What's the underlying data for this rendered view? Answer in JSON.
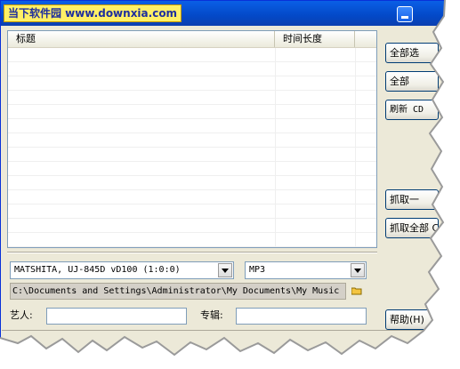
{
  "window": {
    "watermark": "当下软件园 www.downxia.com"
  },
  "list": {
    "columns": [
      "标题",
      "时间长度"
    ],
    "rows": []
  },
  "drive": {
    "selected": "MATSHITA, UJ-845D      vD100  (1:0:0)"
  },
  "format": {
    "selected": "MP3"
  },
  "output_path": "C:\\Documents and Settings\\Administrator\\My Documents\\My Music",
  "fields": {
    "artist_label": "艺人:",
    "artist_value": "",
    "album_label": "专辑:",
    "album_value": ""
  },
  "buttons": {
    "select_all": "全部选",
    "select_none": "全部",
    "refresh": "刷新 CD",
    "rip_one": "抓取一",
    "rip_all": "抓取全部 C",
    "help": "帮助(H)"
  }
}
